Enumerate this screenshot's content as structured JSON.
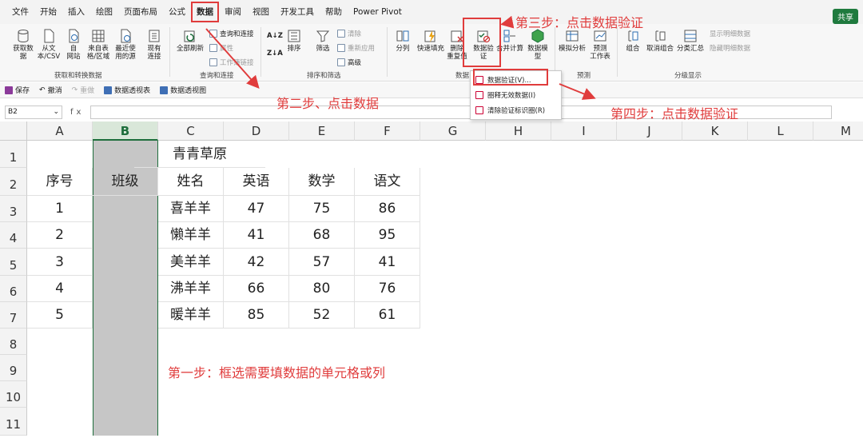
{
  "menu": {
    "items": [
      "文件",
      "开始",
      "插入",
      "绘图",
      "页面布局",
      "公式",
      "数据",
      "审阅",
      "视图",
      "开发工具",
      "帮助",
      "Power Pivot"
    ],
    "active_index": 6,
    "share": "共享"
  },
  "ribbon": {
    "get_data": {
      "btn1": "获取数\n据",
      "btn2": "从文\n本/CSV",
      "btn3": "自\n网站",
      "btn4": "来自表\n格/区域",
      "btn5": "最近使\n用的源",
      "btn6": "现有\n连接",
      "group": "获取和转换数据"
    },
    "query": {
      "refresh": "全部刷新",
      "q1": "查询和连接",
      "q2": "属性",
      "q3": "工作簿链接",
      "group": "查询和连接"
    },
    "sort": {
      "az": "A↓Z",
      "za": "Z↓A",
      "sort": "排序",
      "filter": "筛选",
      "clear": "清除",
      "reapply": "重新应用",
      "advanced": "高级",
      "group": "排序和筛选"
    },
    "tools": {
      "split": "分列",
      "flash": "快速填充",
      "remove_dup": "删除\n重复值",
      "validation": "数据验\n证",
      "consolidate": "合并计算",
      "model": "数据模\n型",
      "group": "数据"
    },
    "forecast": {
      "whatif": "模拟分析",
      "sheet": "预测\n工作表",
      "group": "预测"
    },
    "outline": {
      "group_btn": "组合",
      "ungroup": "取消组合",
      "subtotal": "分类汇总",
      "show": "显示明细数据",
      "hide": "隐藏明细数据",
      "group": "分级显示"
    }
  },
  "dropdown": {
    "items": [
      "数据验证(V)...",
      "圈释无效数据(I)",
      "清除验证标识圈(R)"
    ]
  },
  "qat": {
    "save": "保存",
    "undo": "撤消",
    "redo": "重做",
    "pivot1": "数据透视表",
    "pivot2": "数据透视图"
  },
  "formula": {
    "namebox": "B2",
    "fx": "fx"
  },
  "columns": [
    "A",
    "B",
    "C",
    "D",
    "E",
    "F",
    "G",
    "H",
    "I",
    "J",
    "K",
    "L",
    "M"
  ],
  "rows": [
    "1",
    "2",
    "3",
    "4",
    "5",
    "6",
    "7",
    "8",
    "9",
    "10",
    "11"
  ],
  "sheet": {
    "title": "青青草原",
    "headers": [
      "序号",
      "班级",
      "姓名",
      "英语",
      "数学",
      "语文"
    ],
    "data": [
      [
        "1",
        "",
        "喜羊羊",
        "47",
        "75",
        "86"
      ],
      [
        "2",
        "",
        "懒羊羊",
        "41",
        "68",
        "95"
      ],
      [
        "3",
        "",
        "美羊羊",
        "42",
        "57",
        "41"
      ],
      [
        "4",
        "",
        "沸羊羊",
        "66",
        "80",
        "76"
      ],
      [
        "5",
        "",
        "暖羊羊",
        "85",
        "52",
        "61"
      ]
    ]
  },
  "annotations": {
    "step1": "第一步：框选需要填数据的单元格或列",
    "step2": "第二步、点击数据",
    "step3": "第三步：点击数据验证",
    "step4": "第四步：点击数据验证"
  },
  "colors": {
    "accent_red": "#e03c3c",
    "excel_green": "#1e6e3c",
    "selection": "#c6c6c6"
  }
}
